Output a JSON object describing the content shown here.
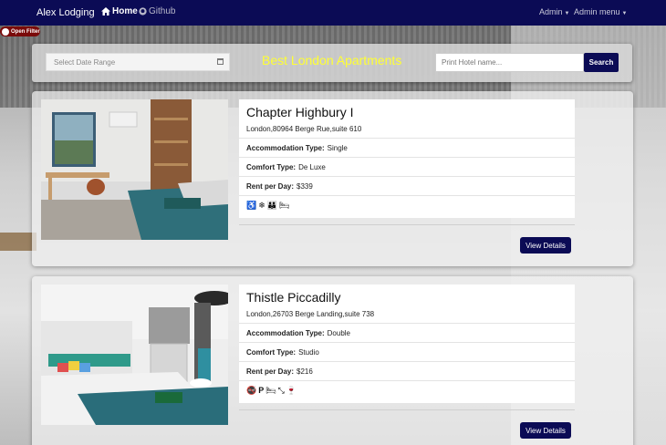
{
  "navbar": {
    "brand": "Alex Lodging",
    "home_label": "Home",
    "github_label": "Github",
    "admin_label": "Admin",
    "admin_menu_label": "Admin menu"
  },
  "filter": {
    "open_label": "Open Filter"
  },
  "search": {
    "date_placeholder": "Select Date Range",
    "title": "Best London Apartments",
    "hotel_placeholder": "Print Hotel name...",
    "button_label": "Search"
  },
  "hotels": [
    {
      "name": "Chapter Highbury I",
      "address": "London,80964 Berge Rue,suite 610",
      "accommodation_label": "Accommodation Type:",
      "accommodation": "Single",
      "comfort_label": "Comfort Type:",
      "comfort": "De Luxe",
      "rent_label": "Rent per Day:",
      "rent": "$339",
      "amenities": [
        "wheelchair-icon",
        "snowflake-icon",
        "family-icon",
        "bed-icon"
      ],
      "details_label": "View Details"
    },
    {
      "name": "Thistle Piccadilly",
      "address": "London,26703 Berge Landing,suite 738",
      "accommodation_label": "Accommodation Type:",
      "accommodation": "Double",
      "comfort_label": "Comfort Type:",
      "comfort": "Studio",
      "rent_label": "Rent per Day:",
      "rent": "$216",
      "amenities": [
        "no-smoking-icon",
        "parking-icon",
        "bed-icon",
        "arrows-icon",
        "glass-icon"
      ],
      "details_label": "View Details"
    }
  ],
  "colors": {
    "navbar": "#0b0b55",
    "title": "#ffff33",
    "filter": "#7a0a0a",
    "button": "#0b0b55"
  }
}
